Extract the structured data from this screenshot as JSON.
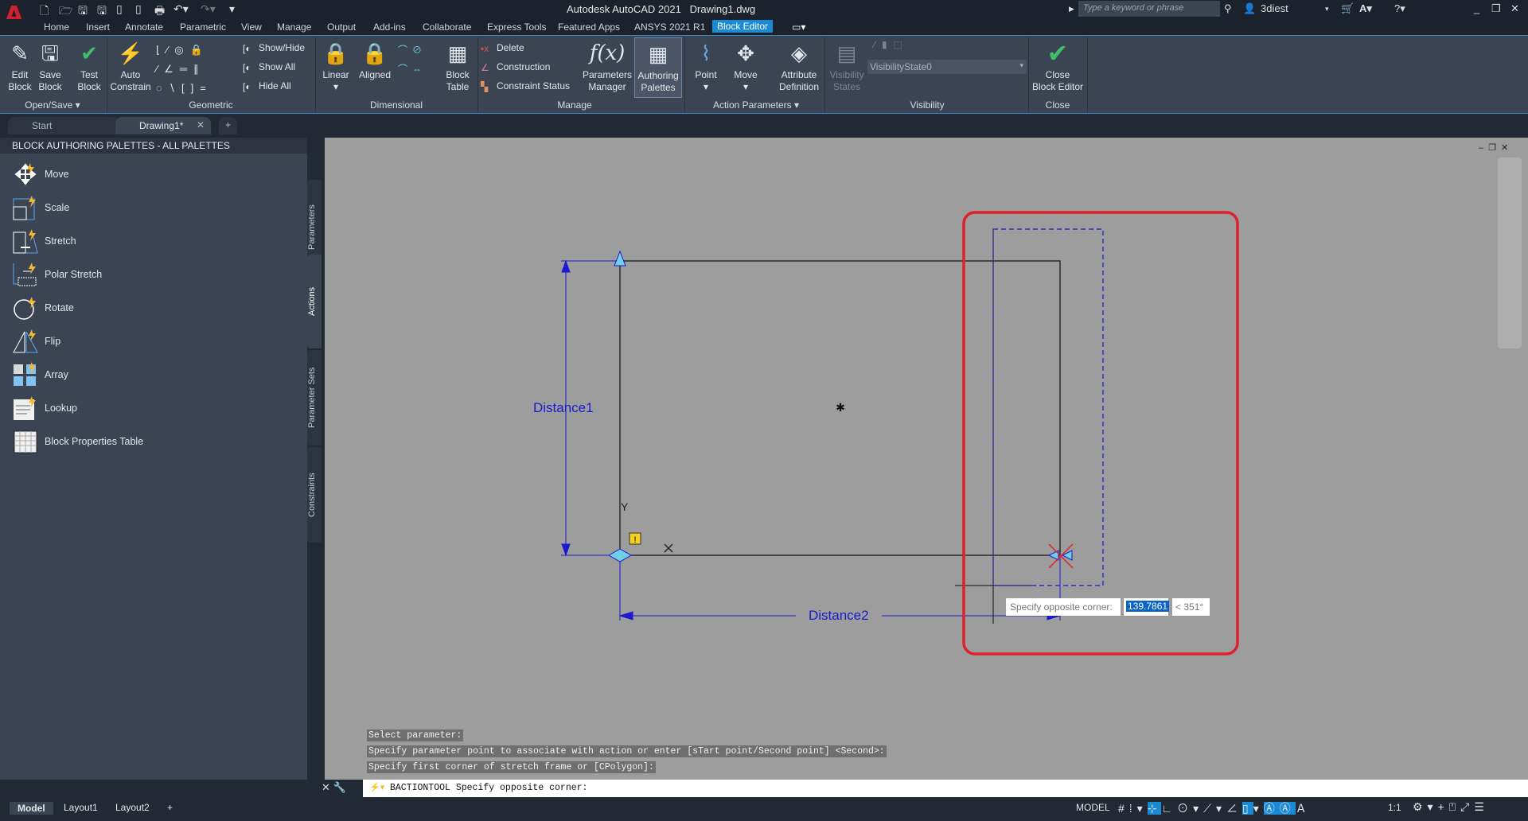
{
  "app": {
    "title": "Autodesk AutoCAD 2021",
    "document": "Drawing1.dwg",
    "search_placeholder": "Type a keyword or phrase",
    "user": "3diest"
  },
  "ribbon_tabs": [
    "Home",
    "Insert",
    "Annotate",
    "Parametric",
    "View",
    "Manage",
    "Output",
    "Add-ins",
    "Collaborate",
    "Express Tools",
    "Featured Apps",
    "ANSYS  2021 R1",
    "Block Editor"
  ],
  "active_tab": "Block Editor",
  "ribbon": {
    "open_save": {
      "label": "Open/Save",
      "edit_block": "Edit\nBlock",
      "save_block": "Save\nBlock"
    },
    "geometric": {
      "label": "Geometric",
      "test_block": "Test\nBlock",
      "auto_constrain": "Auto\nConstrain",
      "show_hide": "Show/Hide",
      "show_all": "Show All",
      "hide_all": "Hide All"
    },
    "dimensional": {
      "label": "Dimensional",
      "linear": "Linear",
      "aligned": "Aligned",
      "block_table": "Block\nTable"
    },
    "manage": {
      "label": "Manage",
      "delete": "Delete",
      "construction": "Construction",
      "constraint_status": "Constraint Status",
      "parameters_manager": "Parameters\nManager",
      "authoring_palettes": "Authoring\nPalettes"
    },
    "action_parameters": {
      "label": "Action Parameters",
      "point": "Point",
      "move": "Move",
      "attribute_definition": "Attribute\nDefinition"
    },
    "visibility": {
      "label": "Visibility",
      "visibility_states": "Visibility\nStates",
      "state_value": "VisibilityState0"
    },
    "close": {
      "label": "Close",
      "close_block_editor": "Close\nBlock Editor"
    }
  },
  "file_tabs": [
    {
      "label": "Start"
    },
    {
      "label": "Drawing1*",
      "active": true
    }
  ],
  "palette": {
    "title": "BLOCK AUTHORING PALETTES - ALL PALETTES",
    "items": [
      "Move",
      "Scale",
      "Stretch",
      "Polar Stretch",
      "Rotate",
      "Flip",
      "Array",
      "Lookup",
      "Block Properties Table"
    ],
    "side_tabs": [
      "Parameters",
      "Actions",
      "Parameter Sets",
      "Constraints"
    ],
    "active_side_tab": "Actions"
  },
  "drawing": {
    "distance1": "Distance1",
    "distance2": "Distance2",
    "y_label": "Y",
    "tooltip_prompt": "Specify opposite corner:",
    "tooltip_value": "139.7861",
    "tooltip_angle": "< 351°",
    "highlight_color": "#e0202a",
    "param_color": "#1a1ad0"
  },
  "command": {
    "history": [
      "Select parameter:",
      "Specify parameter point to associate with action or enter [sTart point/Second point] <Second>:",
      "Specify first corner of stretch frame or [CPolygon]:"
    ],
    "current": "BACTIONTOOL Specify opposite corner: "
  },
  "layout_tabs": [
    "Model",
    "Layout1",
    "Layout2"
  ],
  "status": {
    "model": "MODEL",
    "scale": "1:1"
  }
}
